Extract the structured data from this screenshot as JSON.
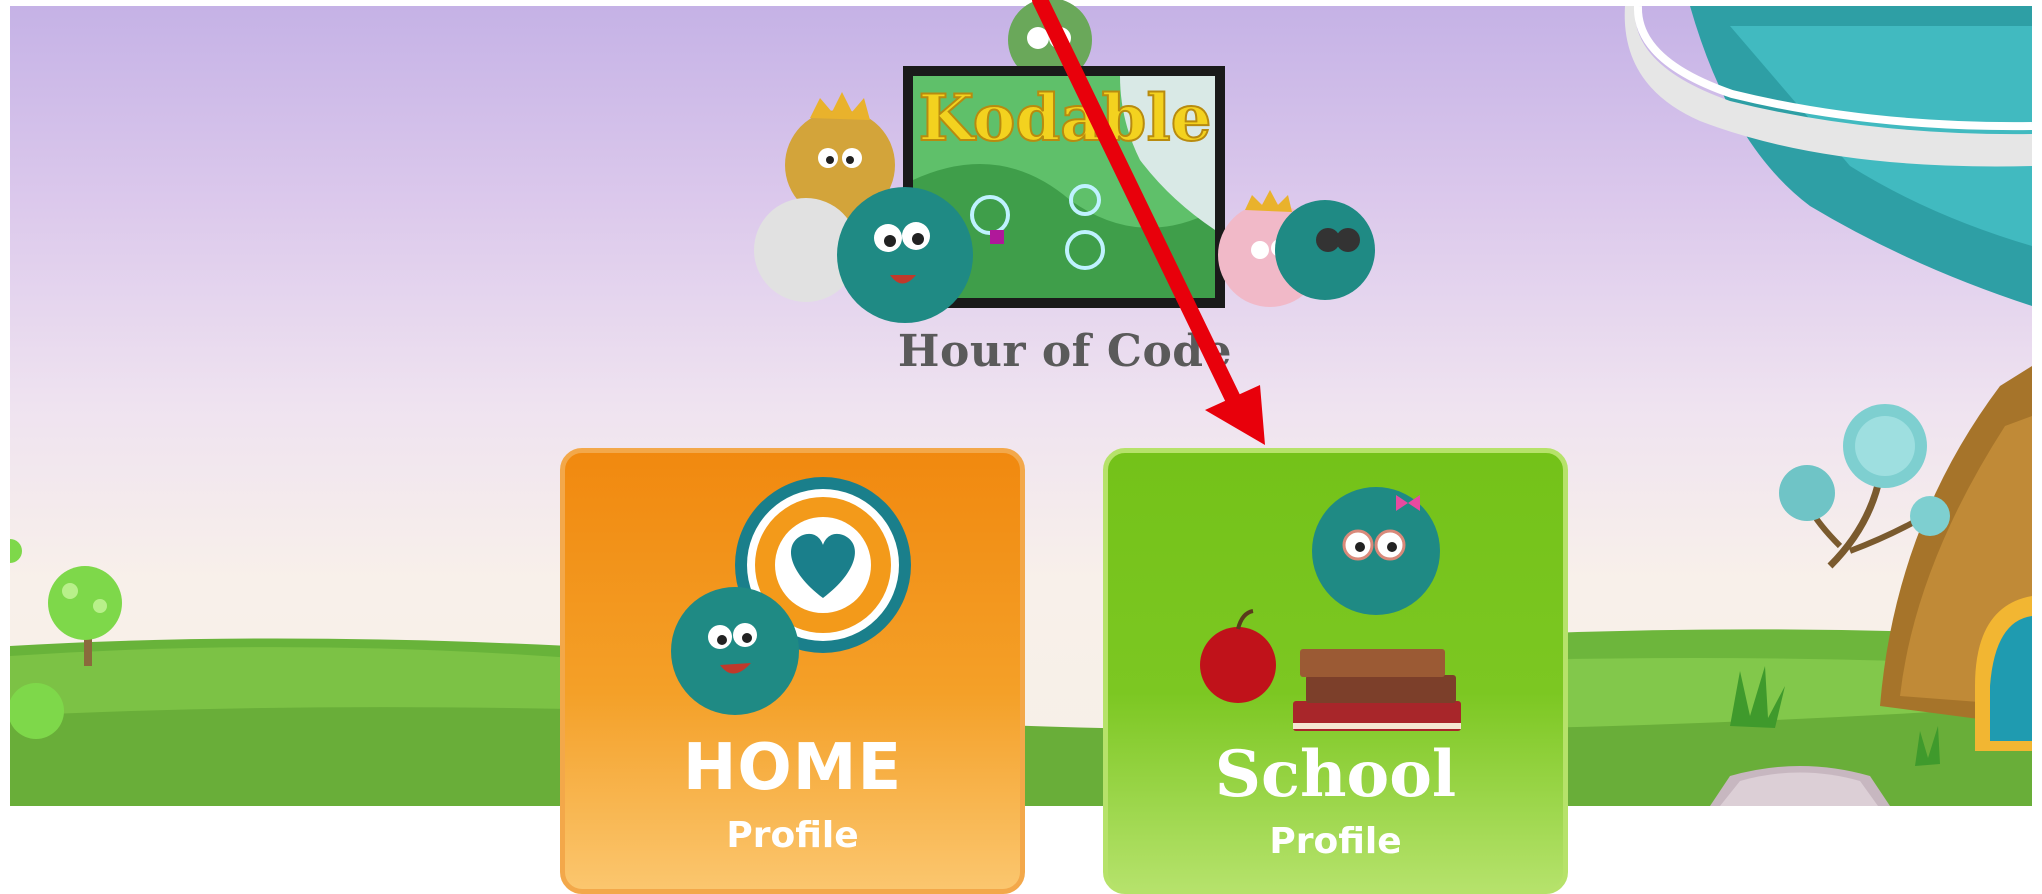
{
  "hero": {
    "logo_text": "Kodable",
    "title": "Hour of Code"
  },
  "cards": {
    "home": {
      "title": "HOME",
      "subtitle": "Profile"
    },
    "school": {
      "title": "School",
      "subtitle": "Profile"
    }
  },
  "colors": {
    "home_orange": "#f1890f",
    "school_green": "#74c219",
    "arrow_red": "#e8000b",
    "fuzz_teal": "#1f8a84"
  }
}
